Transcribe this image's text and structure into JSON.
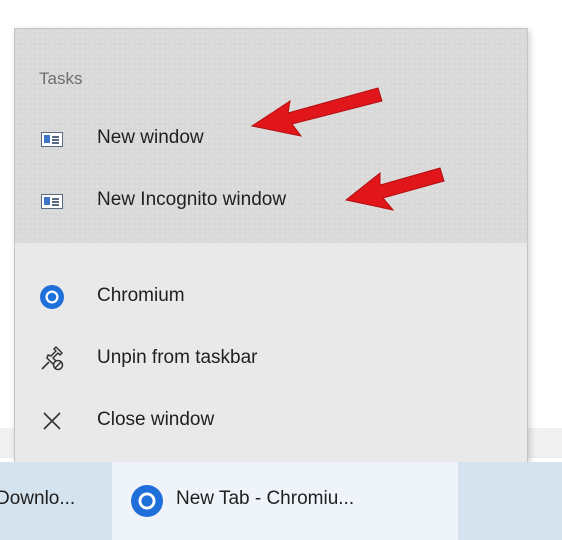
{
  "jumplist": {
    "tasks_header": "Tasks",
    "tasks": [
      {
        "label": "New window",
        "icon": "window-icon"
      },
      {
        "label": "New Incognito window",
        "icon": "window-icon"
      }
    ],
    "app_items": [
      {
        "label": "Chromium",
        "icon": "chromium-icon"
      },
      {
        "label": "Unpin from taskbar",
        "icon": "unpin-icon"
      },
      {
        "label": "Close window",
        "icon": "close-icon"
      }
    ]
  },
  "taskbar": {
    "items": [
      {
        "label": "Downlo...",
        "active": false
      },
      {
        "label": "New Tab - Chromiu...",
        "active": true,
        "icon": "chromium-icon"
      }
    ]
  },
  "colors": {
    "annotation_arrow": "#e0161a",
    "chromium_blue": "#1e6fd9",
    "taskbar_bg": "#d4e3ee"
  }
}
